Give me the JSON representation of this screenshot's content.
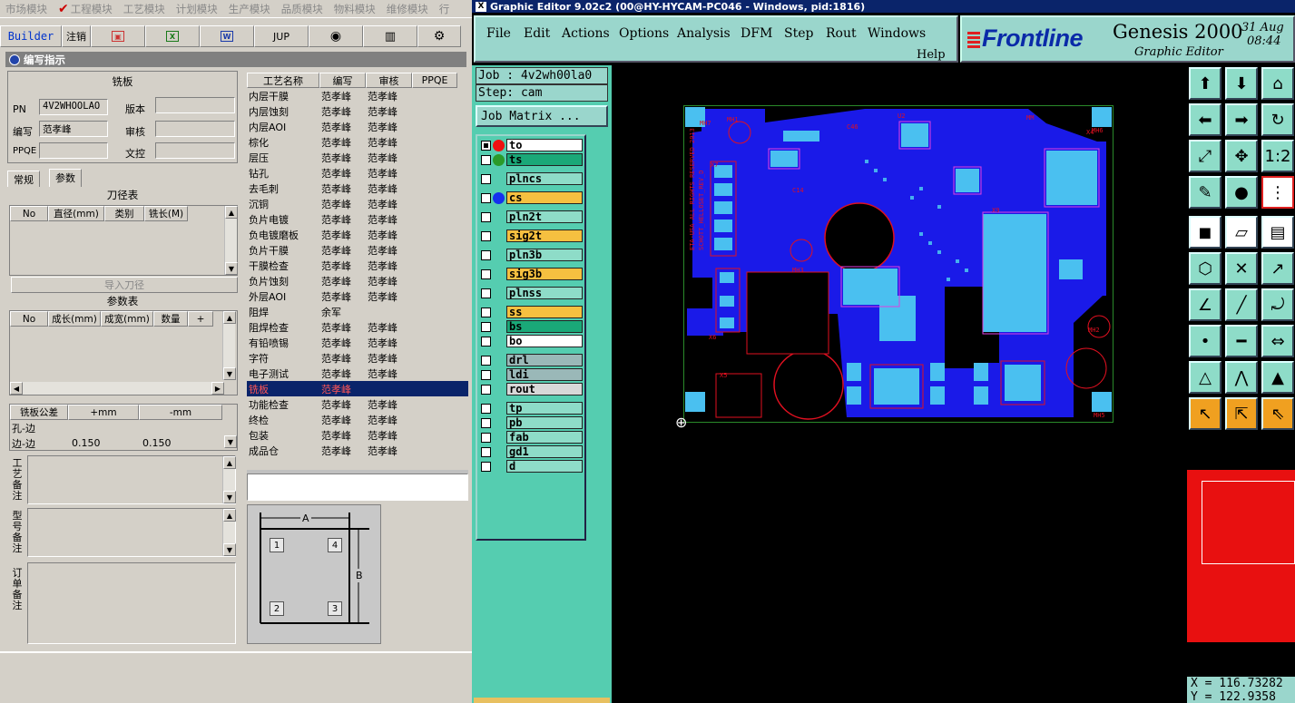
{
  "left": {
    "modules": [
      "市场模块",
      "工程模块",
      "工艺模块",
      "计划模块",
      "生产模块",
      "品质模块",
      "物料模块",
      "维修模块",
      "行"
    ],
    "toolbar": {
      "builder": "Builder",
      "logout": "注销",
      "jup": "JUP"
    },
    "panel_title": "编写指示",
    "mill": {
      "title": "铣板",
      "pn_label": "PN",
      "pn_value": "4V2WHOOLAO",
      "version_label": "版本",
      "version_value": "",
      "writer_label": "编写",
      "writer_value": "范孝峰",
      "review_label": "审核",
      "review_value": "",
      "ppqe_label": "PPQE",
      "ppqe_value": "",
      "control_label": "文控",
      "control_value": ""
    },
    "tabs": [
      "常规",
      "参数"
    ],
    "tool_table": {
      "title": "刀径表",
      "headers": [
        "No",
        "直径(mm)",
        "类别",
        "铣长(M)"
      ]
    },
    "import_button": "导入刀径",
    "param_table": {
      "title": "参数表",
      "headers": [
        "No",
        "成长(mm)",
        "成宽(mm)",
        "数量",
        "+"
      ]
    },
    "tolerance": {
      "headers": [
        "铣板公差",
        "+mm",
        "-mm"
      ],
      "rows": [
        {
          "name": "孔-边",
          "plus": "",
          "minus": ""
        },
        {
          "name": "边-边",
          "plus": "0.150",
          "minus": "0.150"
        }
      ]
    },
    "notes": {
      "process_note": "工艺备注",
      "model_note": "型号备注",
      "order_note": "订单备注"
    },
    "process_table": {
      "headers": [
        "工艺名称",
        "编写",
        "审核",
        "PPQE"
      ],
      "rows": [
        {
          "name": "内层干膜",
          "writer": "范孝峰",
          "reviewer": "范孝峰"
        },
        {
          "name": "内层蚀刻",
          "writer": "范孝峰",
          "reviewer": "范孝峰"
        },
        {
          "name": "内层AOI",
          "writer": "范孝峰",
          "reviewer": "范孝峰"
        },
        {
          "name": "棕化",
          "writer": "范孝峰",
          "reviewer": "范孝峰"
        },
        {
          "name": "层压",
          "writer": "范孝峰",
          "reviewer": "范孝峰"
        },
        {
          "name": "钻孔",
          "writer": "范孝峰",
          "reviewer": "范孝峰"
        },
        {
          "name": "去毛刺",
          "writer": "范孝峰",
          "reviewer": "范孝峰"
        },
        {
          "name": "沉铜",
          "writer": "范孝峰",
          "reviewer": "范孝峰"
        },
        {
          "name": "负片电镀",
          "writer": "范孝峰",
          "reviewer": "范孝峰"
        },
        {
          "name": "负电镀磨板",
          "writer": "范孝峰",
          "reviewer": "范孝峰"
        },
        {
          "name": "负片干膜",
          "writer": "范孝峰",
          "reviewer": "范孝峰"
        },
        {
          "name": "干膜检查",
          "writer": "范孝峰",
          "reviewer": "范孝峰"
        },
        {
          "name": "负片蚀刻",
          "writer": "范孝峰",
          "reviewer": "范孝峰"
        },
        {
          "name": "外层AOI",
          "writer": "范孝峰",
          "reviewer": "范孝峰"
        },
        {
          "name": "阻焊",
          "writer": "余军",
          "reviewer": ""
        },
        {
          "name": "阻焊检查",
          "writer": "范孝峰",
          "reviewer": "范孝峰"
        },
        {
          "name": "有铅喷锡",
          "writer": "范孝峰",
          "reviewer": "范孝峰"
        },
        {
          "name": "字符",
          "writer": "范孝峰",
          "reviewer": "范孝峰"
        },
        {
          "name": "电子测试",
          "writer": "范孝峰",
          "reviewer": "范孝峰"
        },
        {
          "name": "铣板",
          "writer": "范孝峰",
          "reviewer": ""
        },
        {
          "name": "功能检查",
          "writer": "范孝峰",
          "reviewer": "范孝峰"
        },
        {
          "name": "终检",
          "writer": "范孝峰",
          "reviewer": "范孝峰"
        },
        {
          "name": "包装",
          "writer": "范孝峰",
          "reviewer": "范孝峰"
        },
        {
          "name": "成品仓",
          "writer": "范孝峰",
          "reviewer": "范孝峰"
        }
      ]
    },
    "diagram": {
      "a": "A",
      "b": "B",
      "n1": "1",
      "n2": "2",
      "n3": "3",
      "n4": "4"
    }
  },
  "right": {
    "title": "Graphic Editor 9.02c2 (00@HY-HYCAM-PC046 - Windows, pid:1816)",
    "menu": [
      "File",
      "Edit",
      "Actions",
      "Options",
      "Analysis",
      "DFM",
      "Step",
      "Rout",
      "Windows"
    ],
    "help": "Help",
    "brand": {
      "logo": "Frontline",
      "product": "Genesis 2000",
      "subtitle": "Graphic Editor",
      "date": "31 Aug",
      "time": "08:44"
    },
    "job": "Job : 4v2wh00la0",
    "step": "Step: cam",
    "job_matrix": "Job Matrix ...",
    "layers": [
      {
        "name": "to",
        "color": "#ffffff",
        "dot": "#ee1111",
        "checked": true
      },
      {
        "name": "ts",
        "color": "#1aa878",
        "dot": "#2a9a2a",
        "checked": false
      },
      {
        "name": "plncs",
        "color": "#8edcc8",
        "dot": "",
        "checked": false
      },
      {
        "name": "cs",
        "color": "#f6c040",
        "dot": "#1530ee",
        "checked": false
      },
      {
        "name": "pln2t",
        "color": "#8edcc8",
        "dot": "",
        "checked": false
      },
      {
        "name": "sig2t",
        "color": "#f6c040",
        "dot": "",
        "checked": false
      },
      {
        "name": "pln3b",
        "color": "#8edcc8",
        "dot": "",
        "checked": false
      },
      {
        "name": "sig3b",
        "color": "#f6c040",
        "dot": "",
        "checked": false
      },
      {
        "name": "plnss",
        "color": "#8edcc8",
        "dot": "",
        "checked": false
      },
      {
        "name": "ss",
        "color": "#f6c040",
        "dot": "",
        "checked": false
      },
      {
        "name": "bs",
        "color": "#1aa878",
        "dot": "",
        "checked": false
      },
      {
        "name": "bo",
        "color": "#ffffff",
        "dot": "",
        "checked": false
      },
      {
        "name": "drl",
        "color": "#9ab8b8",
        "dot": "",
        "checked": false
      },
      {
        "name": "ldi",
        "color": "#9ab8b8",
        "dot": "",
        "checked": false
      },
      {
        "name": "rout",
        "color": "#d8d8d8",
        "dot": "",
        "checked": false
      },
      {
        "name": "tp",
        "color": "#8edcc8",
        "dot": "",
        "checked": false
      },
      {
        "name": "pb",
        "color": "#8edcc8",
        "dot": "",
        "checked": false
      },
      {
        "name": "fab",
        "color": "#8edcc8",
        "dot": "",
        "checked": false
      },
      {
        "name": "gd1",
        "color": "#8edcc8",
        "dot": "",
        "checked": false
      },
      {
        "name": "d",
        "color": "#8edcc8",
        "dot": "",
        "checked": false
      }
    ],
    "coords": {
      "x": "X = 116.73282",
      "y": "Y = 122.9358"
    }
  }
}
